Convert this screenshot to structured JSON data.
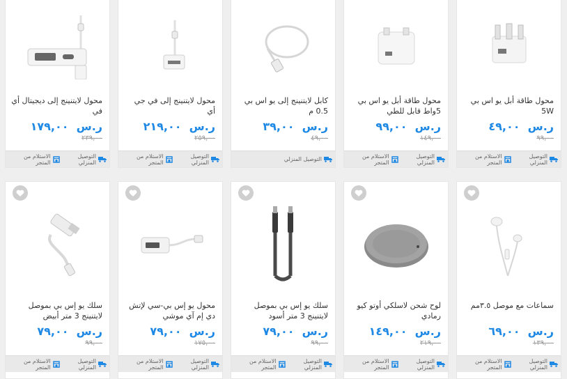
{
  "delivery": {
    "home_label": "التوصيل المنزلي",
    "pickup_label": "الاستلام من المتجر"
  },
  "currency": "ر.س",
  "products": [
    {
      "title": "محول طاقة أبل يو اس بي 5W",
      "price": "٤٩,٠٠",
      "old_price": "٩٩,٠٠",
      "icon": "wall-charger-3pin-icon"
    },
    {
      "title": "محول طاقة أبل يو اس بي 5واط قابل للطي",
      "price": "٩٩,٠٠",
      "old_price": "١٤٩,٠٠",
      "icon": "folding-charger-icon"
    },
    {
      "title": "كابل لايتنينج إلى يو اس بي 0.5 م",
      "price": "٣٩,٠٠",
      "old_price": "٤٩,٠٠",
      "icon": "lightning-cable-icon"
    },
    {
      "title": "محول لايتنينج إلى في جي أي",
      "price": "٢١٩,٠٠",
      "old_price": "٢٥٩,٠٠",
      "icon": "vga-adapter-icon"
    },
    {
      "title": "محول لايتنينج إلى ديجيتال أي في",
      "price": "١٧٩,٠٠",
      "old_price": "٢٣٩,٠٠",
      "icon": "hdmi-adapter-icon"
    },
    {
      "title": "سماعات مع موصل ٣.٥مم",
      "price": "٦٩,٠٠",
      "old_price": "١٣٩,٠٠",
      "icon": "earphones-icon"
    },
    {
      "title": "لوح شحن لاسلكي أوتو كيو رمادي",
      "price": "١٤٩,٠٠",
      "old_price": "٢١٩,٠٠",
      "icon": "wireless-pad-icon"
    },
    {
      "title": "سلك يو إس بي بموصل لايتنينج 3 متر أسود",
      "price": "٧٩,٠٠",
      "old_price": "٩٩,٠٠",
      "icon": "black-cable-icon"
    },
    {
      "title": "محول يو إس بي-سي لإتش دي إم آي موشي",
      "price": "٧٩,٠٠",
      "old_price": "١٧٥,٠٠",
      "icon": "usbc-hdmi-adapter-icon"
    },
    {
      "title": "سلك يو إس بي بموصل لايتنينج 3 متر أبيض",
      "price": "٧٩,٠٠",
      "old_price": "٩٩,٠٠",
      "icon": "white-cable-icon"
    }
  ]
}
